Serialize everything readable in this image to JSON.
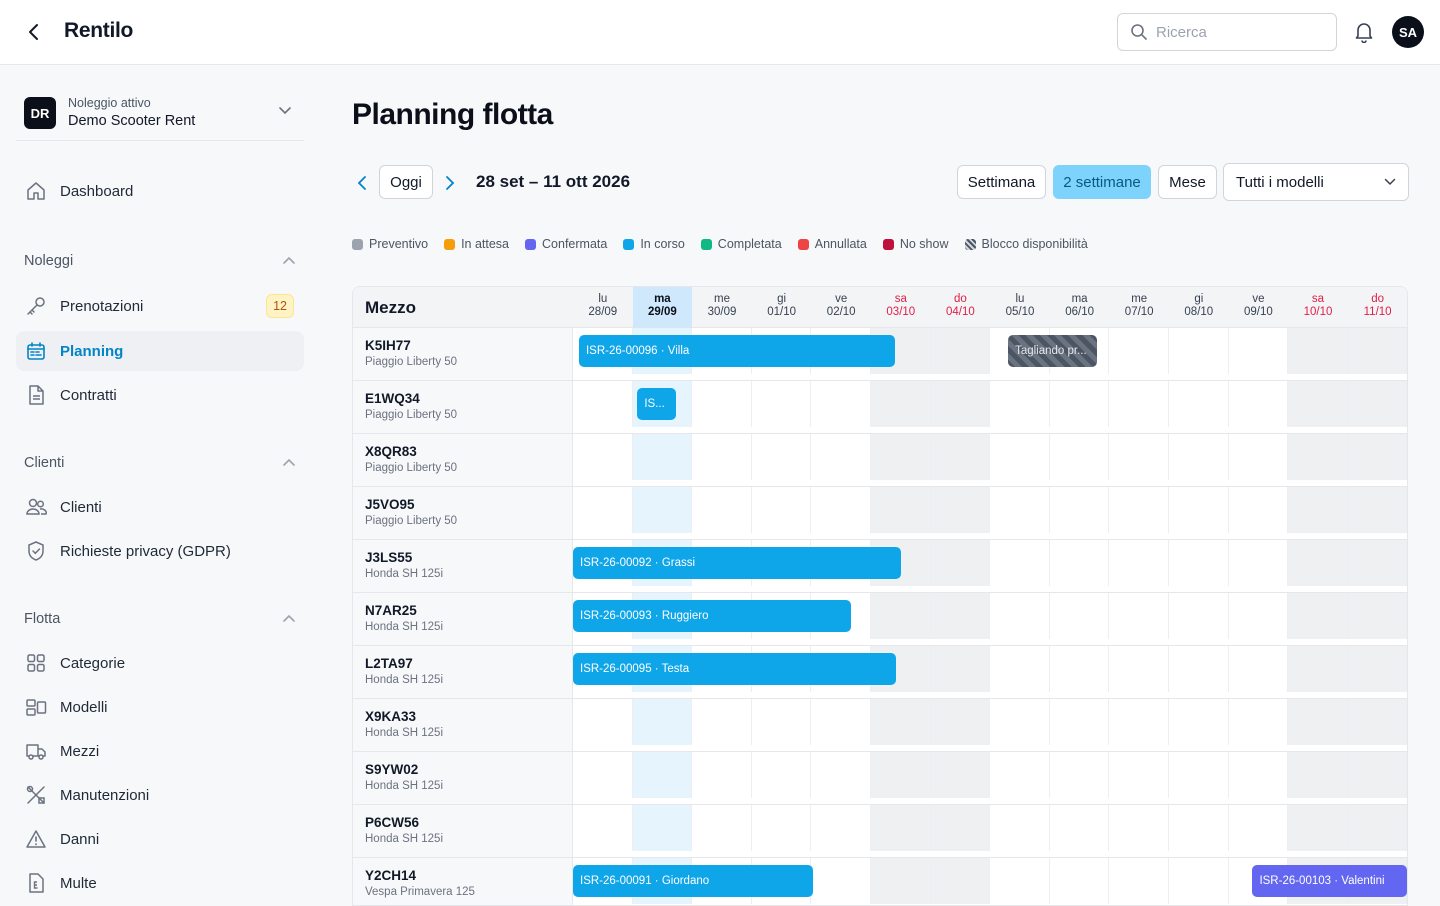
{
  "app": {
    "title": "Rentilo",
    "user_initials": "SA"
  },
  "search": {
    "placeholder": "Ricerca"
  },
  "tenant": {
    "badge": "DR",
    "label": "Noleggio attivo",
    "name": "Demo Scooter Rent"
  },
  "sidebar": {
    "dashboard": "Dashboard",
    "sections": [
      {
        "label": "Noleggi",
        "items": [
          {
            "label": "Prenotazioni",
            "badge": "12",
            "icon": "key-icon"
          },
          {
            "label": "Planning",
            "icon": "calendar-icon",
            "active": true
          },
          {
            "label": "Contratti",
            "icon": "document-icon"
          }
        ]
      },
      {
        "label": "Clienti",
        "items": [
          {
            "label": "Clienti",
            "icon": "users-icon"
          },
          {
            "label": "Richieste privacy (GDPR)",
            "icon": "shield-icon"
          }
        ]
      },
      {
        "label": "Flotta",
        "items": [
          {
            "label": "Categorie",
            "icon": "grid-icon"
          },
          {
            "label": "Modelli",
            "icon": "models-icon"
          },
          {
            "label": "Mezzi",
            "icon": "truck-icon"
          },
          {
            "label": "Manutenzioni",
            "icon": "tools-icon"
          },
          {
            "label": "Danni",
            "icon": "warning-icon"
          },
          {
            "label": "Multe",
            "icon": "receipt-icon"
          }
        ]
      }
    ]
  },
  "main": {
    "title": "Planning flotta",
    "today_button": "Oggi",
    "range": "28 set – 11 ott 2026",
    "views": [
      "Settimana",
      "2 settimane",
      "Mese"
    ],
    "active_view": "2 settimane",
    "model_filter": "Tutti i modelli"
  },
  "legend": [
    {
      "label": "Preventivo",
      "color": "#9ca3af"
    },
    {
      "label": "In attesa",
      "color": "#f59e0b"
    },
    {
      "label": "Confermata",
      "color": "#6366f1"
    },
    {
      "label": "In corso",
      "color": "#0ea5e9"
    },
    {
      "label": "Completata",
      "color": "#10b981"
    },
    {
      "label": "Annullata",
      "color": "#ef4444"
    },
    {
      "label": "No show",
      "color": "#be123c"
    },
    {
      "label": "Blocco disponibilità",
      "color": "hatch"
    }
  ],
  "grid": {
    "header_label": "Mezzo",
    "days": [
      {
        "dow": "lu",
        "date": "28/09"
      },
      {
        "dow": "ma",
        "date": "29/09",
        "today": true
      },
      {
        "dow": "me",
        "date": "30/09"
      },
      {
        "dow": "gi",
        "date": "01/10"
      },
      {
        "dow": "ve",
        "date": "02/10"
      },
      {
        "dow": "sa",
        "date": "03/10",
        "weekend": true
      },
      {
        "dow": "do",
        "date": "04/10",
        "weekend": true
      },
      {
        "dow": "lu",
        "date": "05/10"
      },
      {
        "dow": "ma",
        "date": "06/10"
      },
      {
        "dow": "me",
        "date": "07/10"
      },
      {
        "dow": "gi",
        "date": "08/10"
      },
      {
        "dow": "ve",
        "date": "09/10"
      },
      {
        "dow": "sa",
        "date": "10/10",
        "weekend": true
      },
      {
        "dow": "do",
        "date": "11/10",
        "weekend": true
      }
    ],
    "vehicles": [
      {
        "plate": "K5IH77",
        "model": "Piaggio Liberty 50",
        "bookings": [
          {
            "label": "ISR-26-00096 · Villa",
            "start": 0.1,
            "end": 5.4,
            "type": "in_corso"
          },
          {
            "label": "Tagliando pr...",
            "start": 7.3,
            "end": 8.8,
            "type": "block"
          }
        ]
      },
      {
        "plate": "E1WQ34",
        "model": "Piaggio Liberty 50",
        "bookings": [
          {
            "label": "IS...",
            "start": 1.08,
            "end": 1.72,
            "type": "in_corso"
          }
        ]
      },
      {
        "plate": "X8QR83",
        "model": "Piaggio Liberty 50",
        "bookings": []
      },
      {
        "plate": "J5VO95",
        "model": "Piaggio Liberty 50",
        "bookings": []
      },
      {
        "plate": "J3LS55",
        "model": "Honda SH 125i",
        "bookings": [
          {
            "label": "ISR-26-00092 · Grassi",
            "start": 0,
            "end": 5.5,
            "type": "in_corso"
          }
        ]
      },
      {
        "plate": "N7AR25",
        "model": "Honda SH 125i",
        "bookings": [
          {
            "label": "ISR-26-00093 · Ruggiero",
            "start": 0,
            "end": 4.66,
            "type": "in_corso"
          }
        ]
      },
      {
        "plate": "L2TA97",
        "model": "Honda SH 125i",
        "bookings": [
          {
            "label": "ISR-26-00095 · Testa",
            "start": 0,
            "end": 5.42,
            "type": "in_corso"
          }
        ]
      },
      {
        "plate": "X9KA33",
        "model": "Honda SH 125i",
        "bookings": []
      },
      {
        "plate": "S9YW02",
        "model": "Honda SH 125i",
        "bookings": []
      },
      {
        "plate": "P6CW56",
        "model": "Honda SH 125i",
        "bookings": []
      },
      {
        "plate": "Y2CH14",
        "model": "Vespa Primavera 125",
        "bookings": [
          {
            "label": "ISR-26-00091 · Giordano",
            "start": 0,
            "end": 4.02,
            "type": "in_corso"
          },
          {
            "label": "ISR-26-00103 · Valentini",
            "start": 11.4,
            "end": 14,
            "type": "confermata"
          }
        ]
      }
    ]
  }
}
